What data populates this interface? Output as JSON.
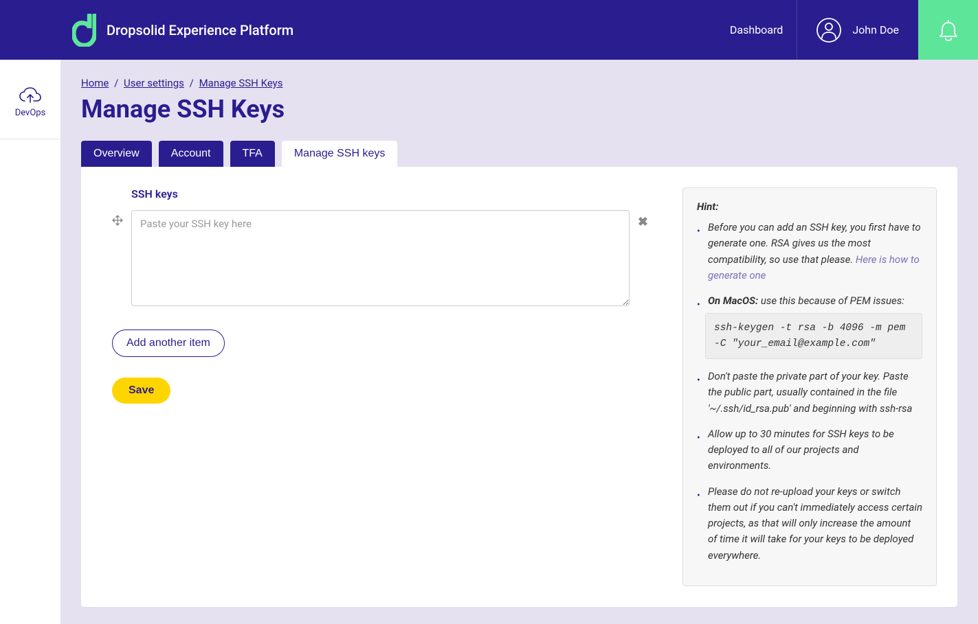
{
  "header": {
    "brand": "Dropsolid Experience Platform",
    "dashboard_link": "Dashboard",
    "user_name": "John Doe"
  },
  "sidebar": {
    "items": [
      {
        "label": "DevOps"
      }
    ]
  },
  "breadcrumb": {
    "home": "Home",
    "user_settings": "User settings",
    "current": "Manage SSH Keys"
  },
  "page": {
    "title": "Manage SSH Keys"
  },
  "tabs": [
    {
      "label": "Overview",
      "active": false
    },
    {
      "label": "Account",
      "active": false
    },
    {
      "label": "TFA",
      "active": false
    },
    {
      "label": "Manage SSH keys",
      "active": true
    }
  ],
  "form": {
    "ssh_label": "SSH keys",
    "ssh_placeholder": "Paste your SSH key here",
    "add_button": "Add another item",
    "save_button": "Save"
  },
  "hint": {
    "title": "Hint:",
    "item1_text": "Before you can add an SSH key, you first have to generate one. RSA gives us the most compatibility, so use that please. ",
    "item1_link": "Here is how to generate one",
    "item2_bold": "On MacOS:",
    "item2_rest": " use this because of PEM issues:",
    "code": "ssh-keygen -t rsa -b 4096 -m pem -C \"your_email@example.com\"",
    "item3": "Don't paste the private part of your key. Paste the public part, usually contained in the file '~/.ssh/id_rsa.pub' and beginning with ssh-rsa",
    "item4": "Allow up to 30 minutes for SSH keys to be deployed to all of our projects and environments.",
    "item5": "Please do not re-upload your keys or switch them out if you can't immediately access certain projects, as that will only increase the amount of time it will take for your keys to be deployed everywhere."
  }
}
